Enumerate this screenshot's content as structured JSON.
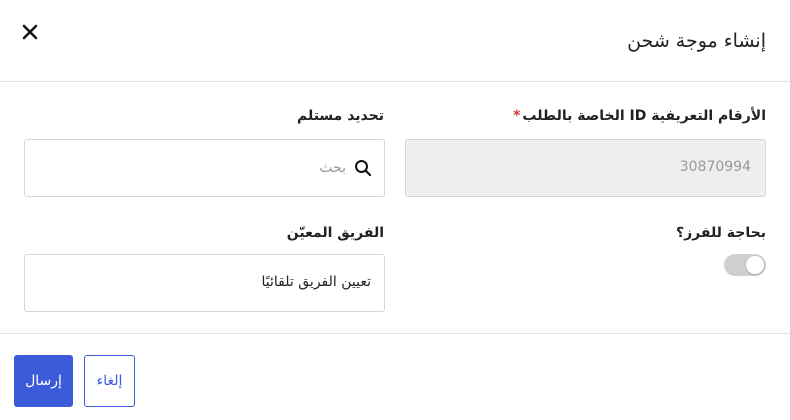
{
  "modal": {
    "title": "إنشاء موجة شحن"
  },
  "form": {
    "order_ids": {
      "label": "الأرقام التعريفية ID الخاصة بالطلب",
      "required_mark": "*",
      "value": "30870994"
    },
    "recipient": {
      "label": "تحديد مستلم",
      "placeholder": "بحث"
    },
    "sorting": {
      "label": "بحاجة للفرز؟",
      "enabled": false
    },
    "assigned_team": {
      "label": "الفريق المعيّن",
      "value": "تعيين الفريق تلقائيًا"
    }
  },
  "footer": {
    "submit_label": "إرسال",
    "cancel_label": "إلغاء"
  },
  "colors": {
    "primary": "#3b5bdb",
    "required": "#e03131",
    "toggle_off": "#cfcfcf"
  }
}
